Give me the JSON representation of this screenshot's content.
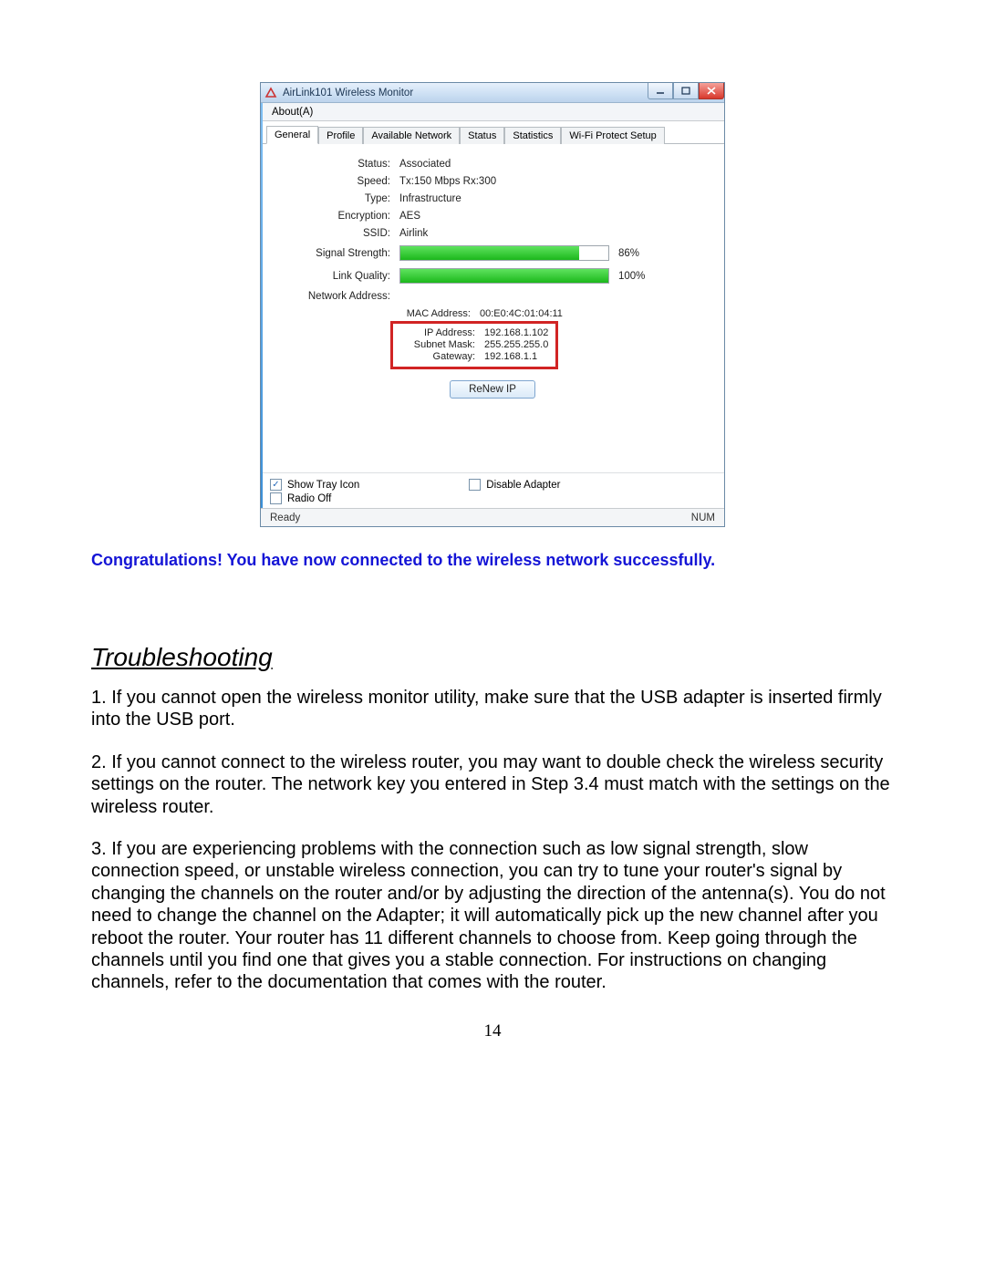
{
  "window": {
    "title": "AirLink101 Wireless Monitor",
    "menu": {
      "about": "About(A)"
    },
    "tabs": [
      "General",
      "Profile",
      "Available Network",
      "Status",
      "Statistics",
      "Wi-Fi Protect Setup"
    ],
    "active_tab": 0,
    "fields": {
      "status_label": "Status:",
      "status_value": "Associated",
      "speed_label": "Speed:",
      "speed_value": "Tx:150 Mbps Rx:300",
      "type_label": "Type:",
      "type_value": "Infrastructure",
      "encryption_label": "Encryption:",
      "encryption_value": "AES",
      "ssid_label": "SSID:",
      "ssid_value": "Airlink",
      "signal_label": "Signal Strength:",
      "signal_pct": "86%",
      "signal_fill": 86,
      "link_label": "Link Quality:",
      "link_pct": "100%",
      "link_fill": 100,
      "net_label": "Network Address:",
      "mac_label": "MAC Address:",
      "mac_value": "00:E0:4C:01:04:11",
      "ip_label": "IP Address:",
      "ip_value": "192.168.1.102",
      "mask_label": "Subnet Mask:",
      "mask_value": "255.255.255.0",
      "gw_label": "Gateway:",
      "gw_value": "192.168.1.1"
    },
    "renew_button": "ReNew IP",
    "options": {
      "show_tray": "Show Tray Icon",
      "radio_off": "Radio Off",
      "disable_adapter": "Disable Adapter"
    },
    "statusbar": {
      "ready": "Ready",
      "num": "NUM"
    }
  },
  "congrats_text": "Congratulations! You have now connected to the wireless network successfully.",
  "section_heading": "Troubleshooting",
  "paragraphs": {
    "p1": "1. If you cannot open the wireless monitor utility, make sure that the USB adapter is inserted firmly into the USB port.",
    "p2": "2. If you cannot connect to the wireless router, you may want to double check the wireless security settings on the router. The network key you entered in Step 3.4 must match with the settings on the wireless router.",
    "p3": "3. If you are experiencing problems with the connection such as low signal strength, slow connection speed, or unstable wireless connection, you can try to tune your router's signal by changing the channels on the router and/or by adjusting the direction of the antenna(s). You do not need to change the channel on the Adapter; it will automatically pick up the new channel after you reboot the router. Your router has 11 different channels to choose from. Keep going through the channels until you find one that gives you a stable connection. For instructions on changing channels, refer to the documentation that comes with the router."
  },
  "page_number": "14"
}
